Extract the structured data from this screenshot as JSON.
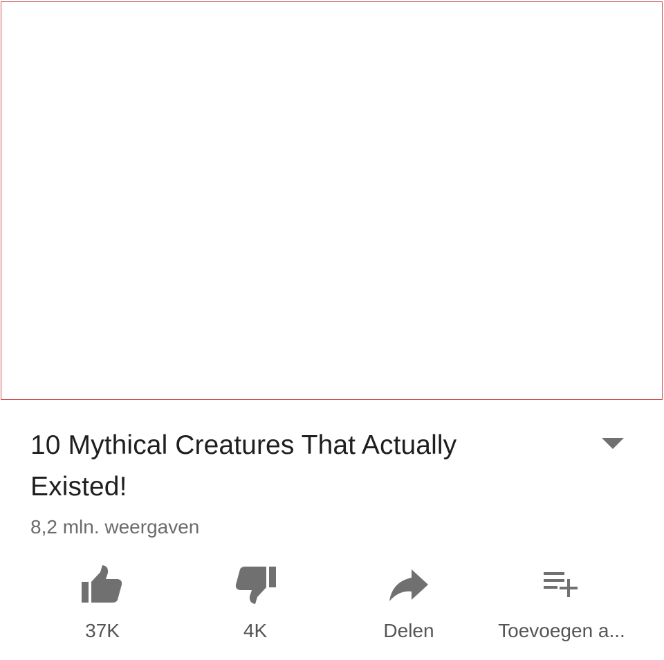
{
  "video": {
    "title": "10 Mythical Creatures That Actually Existed!",
    "views": "8,2 mln. weergaven"
  },
  "actions": {
    "like_label": "37K",
    "dislike_label": "4K",
    "share_label": "Delen",
    "add_label": "Toevoegen a..."
  },
  "icons": {
    "like": "thumbs-up-icon",
    "dislike": "thumbs-down-icon",
    "share": "share-arrow-icon",
    "add": "playlist-add-icon",
    "expand": "caret-down-icon"
  },
  "colors": {
    "player_border": "#d14b4b",
    "icon": "#707070",
    "title": "#1f1f1f",
    "secondary_text": "#6b6b6b"
  }
}
